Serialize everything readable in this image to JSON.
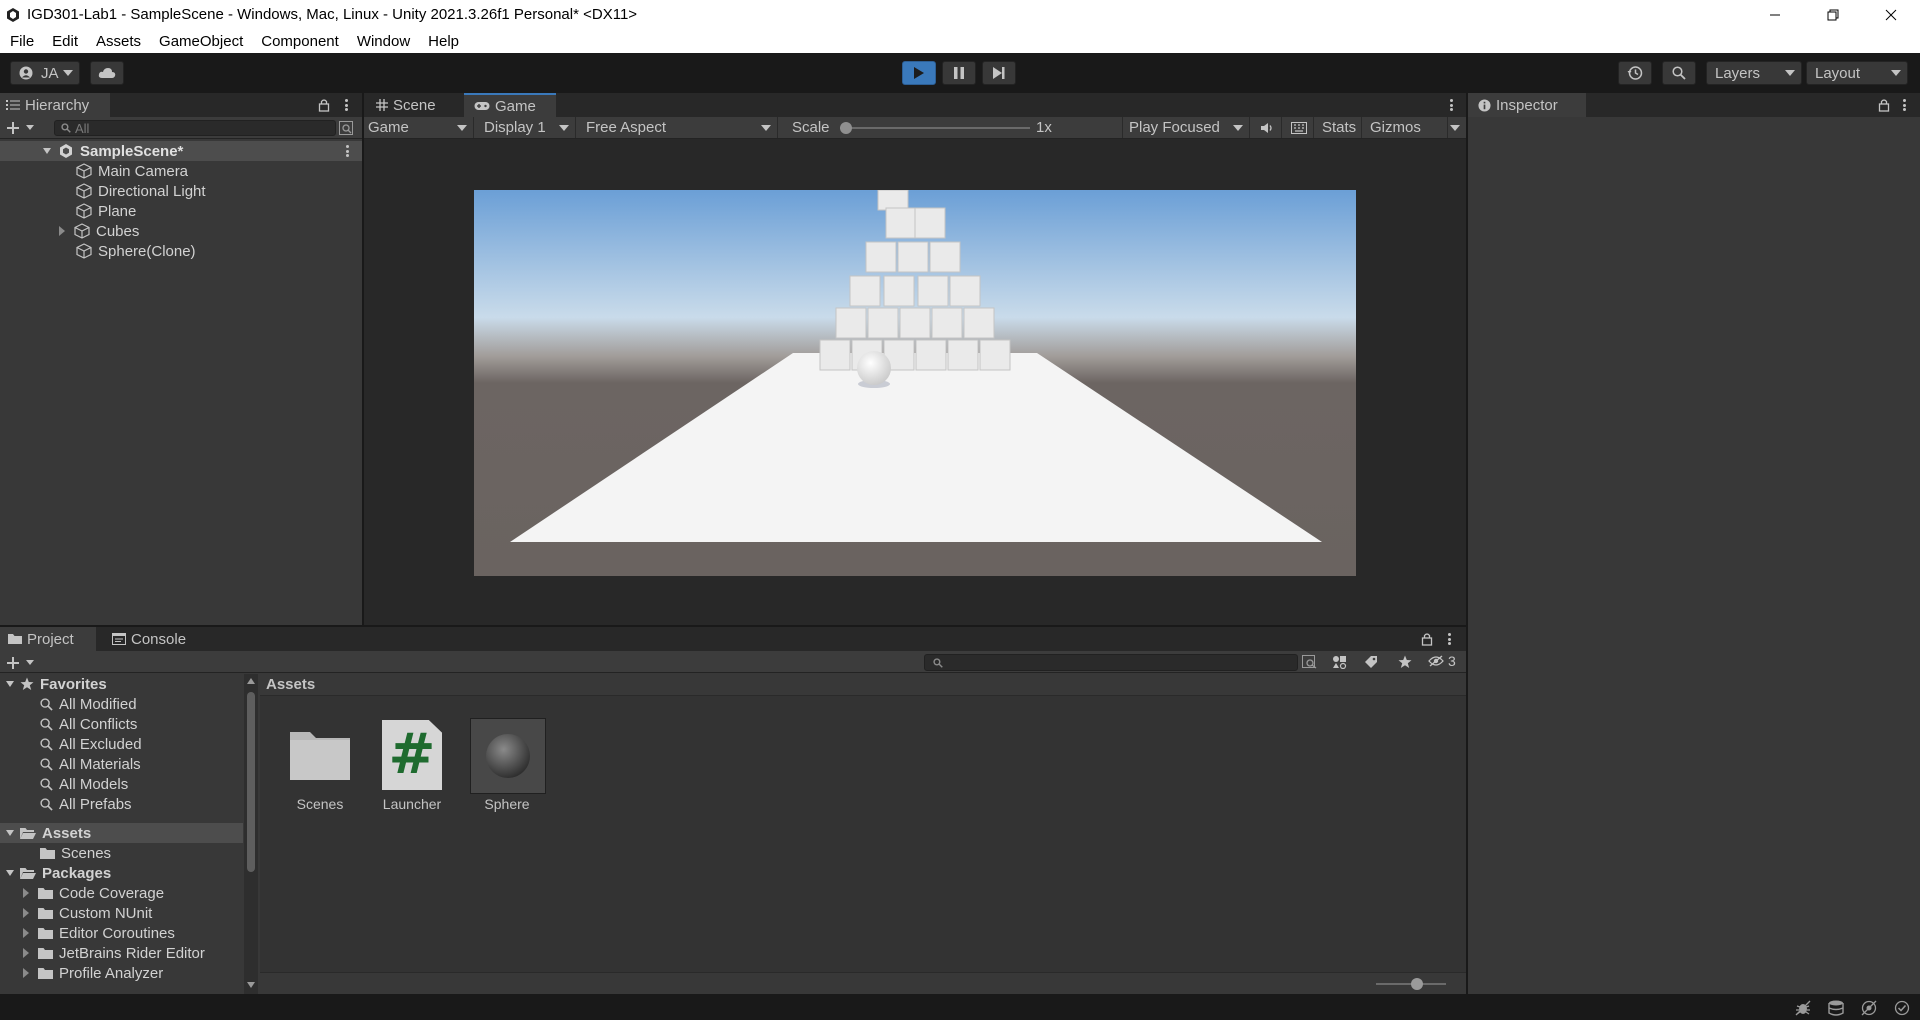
{
  "window": {
    "title": "IGD301-Lab1 - SampleScene - Windows, Mac, Linux - Unity 2021.3.26f1 Personal* <DX11>"
  },
  "menu": [
    "File",
    "Edit",
    "Assets",
    "GameObject",
    "Component",
    "Window",
    "Help"
  ],
  "toolbar": {
    "account_label": "JA",
    "layers_label": "Layers",
    "layout_label": "Layout"
  },
  "hierarchy": {
    "tab_label": "Hierarchy",
    "search_placeholder": "All",
    "scene_name": "SampleScene*",
    "items": [
      "Main Camera",
      "Directional Light",
      "Plane",
      "Cubes",
      "Sphere(Clone)"
    ]
  },
  "scene_tabs": {
    "scene_label": "Scene",
    "game_label": "Game"
  },
  "game_toolbar": {
    "mode": "Game",
    "display": "Display 1",
    "aspect": "Free Aspect",
    "scale_label": "Scale",
    "scale_value": "1x",
    "play_mode": "Play Focused",
    "stats_label": "Stats",
    "gizmos_label": "Gizmos"
  },
  "inspector": {
    "tab_label": "Inspector"
  },
  "project": {
    "project_tab": "Project",
    "console_tab": "Console",
    "hidden_count": "3",
    "favorites_label": "Favorites",
    "favorites": [
      "All Modified",
      "All Conflicts",
      "All Excluded",
      "All Materials",
      "All Models",
      "All Prefabs"
    ],
    "assets_label": "Assets",
    "assets_children": [
      "Scenes"
    ],
    "packages_label": "Packages",
    "packages": [
      "Code Coverage",
      "Custom NUnit",
      "Editor Coroutines",
      "JetBrains Rider Editor",
      "Profile Analyzer"
    ],
    "breadcrumb": "Assets",
    "asset_items": [
      "Scenes",
      "Launcher",
      "Sphere"
    ],
    "script_glyph": "#"
  },
  "colors": {
    "accent": "#3a79bb",
    "panel_bg": "#383838",
    "tab_bg": "#282828",
    "sky_top": "#6b9fd6",
    "ground": "#6c6562"
  }
}
